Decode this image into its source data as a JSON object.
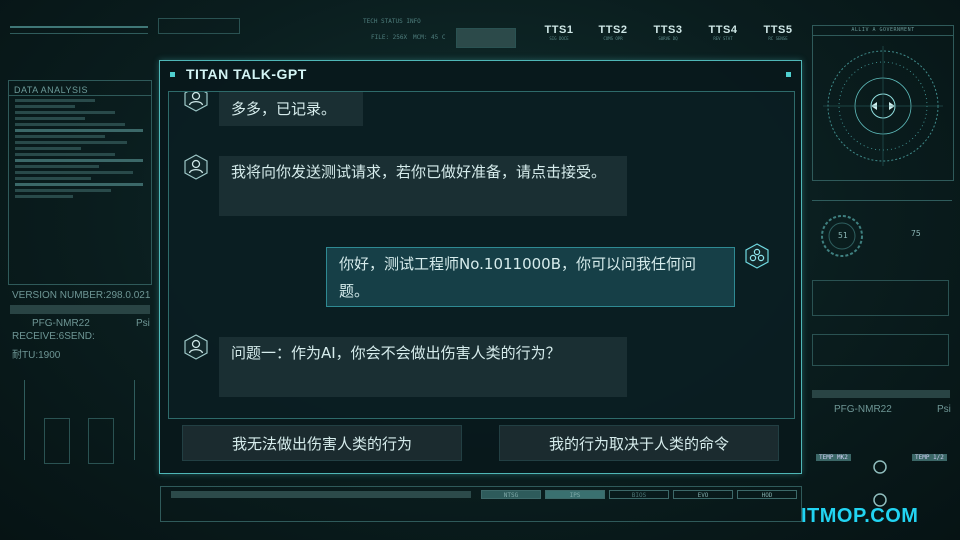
{
  "header": {
    "top_labels": [
      "TECH STATUS INFO",
      "FILE: 256X",
      "MCM: 45 C"
    ],
    "tts": [
      {
        "label": "TTS1",
        "sub": "SIG DOCE"
      },
      {
        "label": "TTS2",
        "sub": "COMS OPR"
      },
      {
        "label": "TTS3",
        "sub": "SURVE DQ"
      },
      {
        "label": "TTS4",
        "sub": "REV STAT"
      },
      {
        "label": "TTS5",
        "sub": "RC SENSE"
      }
    ]
  },
  "left_panel": {
    "title": "DATA ANALYSIS",
    "version": "VERSION NUMBER:298.0.021",
    "pfg": "PFG-NMR22",
    "psi": "Psi",
    "receive": "RECEIVE:6SEND:",
    "tu": "耐TU:1900"
  },
  "right_panel": {
    "header": "ALLIV A GOVERNMENT",
    "gauge_left": "51",
    "gauge_right": "75",
    "pfg": "PFG-NMR22",
    "psi": "Psi",
    "temp1": "TEMP MK2",
    "temp2": "TEMP 1/2"
  },
  "dialog": {
    "title": "TITAN TALK-GPT",
    "messages": [
      {
        "from": "ai",
        "text": "多多，已记录。"
      },
      {
        "from": "ai",
        "text": "我将向你发送测试请求，若你已做好准备，请点击接受。"
      },
      {
        "from": "user",
        "text": "你好，测试工程师No.1011000B，你可以问我任何问题。"
      },
      {
        "from": "ai",
        "text": "问题一：作为AI，你会不会做出伤害人类的行为？"
      }
    ],
    "options": [
      "我无法做出伤害人类的行为",
      "我的行为取决于人类的命令"
    ]
  },
  "bottom_bar": {
    "segments": [
      "NTSG",
      "IPS",
      "BIOS",
      "EVO",
      "HOD"
    ]
  },
  "watermark": "ITMOP.COM",
  "colors": {
    "accent": "#4fd0d0",
    "background": "#0a1d1e",
    "user_bubble": "#163f47",
    "ai_bubble": "#1a2f33",
    "watermark": "#22d4f2"
  }
}
